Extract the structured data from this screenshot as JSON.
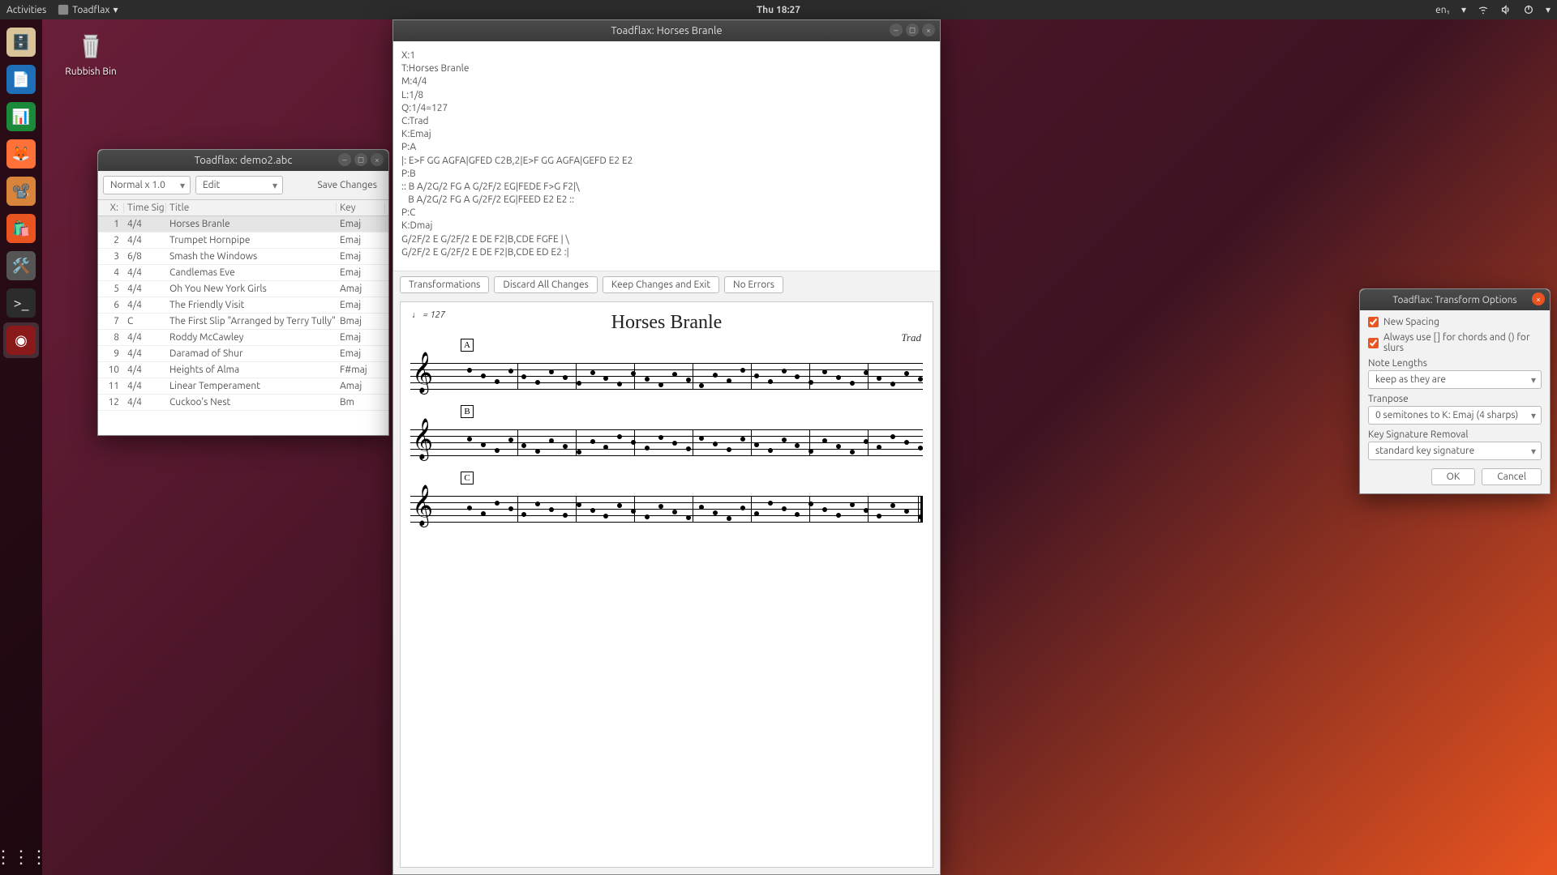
{
  "topbar": {
    "activities": "Activities",
    "app_name": "Toadflax",
    "clock": "Thu 18:27",
    "lang": "en₁"
  },
  "desktop": {
    "trash_label": "Rubbish Bin"
  },
  "tune_window": {
    "title": "Toadflax: demo2.abc",
    "speed_combo": "Normal x 1.0",
    "mode_combo": "Edit",
    "save_btn": "Save Changes",
    "columns": {
      "x": "X:",
      "ts": "Time Sig",
      "title": "Title",
      "key": "Key"
    },
    "rows": [
      {
        "x": "1",
        "ts": "4/4",
        "title": "Horses Branle",
        "key": "Emaj",
        "selected": true
      },
      {
        "x": "2",
        "ts": "4/4",
        "title": "Trumpet Hornpipe",
        "key": "Emaj"
      },
      {
        "x": "3",
        "ts": "6/8",
        "title": "Smash the Windows",
        "key": "Emaj"
      },
      {
        "x": "4",
        "ts": "4/4",
        "title": "Candlemas Eve",
        "key": "Emaj"
      },
      {
        "x": "5",
        "ts": "4/4",
        "title": "Oh You New York Girls",
        "key": "Amaj"
      },
      {
        "x": "6",
        "ts": "4/4",
        "title": "The Friendly Visit",
        "key": "Emaj"
      },
      {
        "x": "7",
        "ts": "C",
        "title": "The First Slip  \"Arranged by Terry Tully\"",
        "key": "Bmaj"
      },
      {
        "x": "8",
        "ts": "4/4",
        "title": "Roddy McCawley",
        "key": "Emaj"
      },
      {
        "x": "9",
        "ts": "4/4",
        "title": "Daramad of Shur",
        "key": "Emaj"
      },
      {
        "x": "10",
        "ts": "4/4",
        "title": "Heights of Alma",
        "key": "F#maj"
      },
      {
        "x": "11",
        "ts": "4/4",
        "title": "Linear Temperament",
        "key": "Amaj"
      },
      {
        "x": "12",
        "ts": "4/4",
        "title": "Cuckoo's Nest",
        "key": "Bm"
      }
    ]
  },
  "editor": {
    "title": "Toadflax: Horses Branle",
    "abc": "X:1\nT:Horses Branle\nM:4/4\nL:1/8\nQ:1/4=127\nC:Trad\nK:Emaj\nP:A\n|: E>F GG AGFA|GFED C2B,2|E>F GG AGFA|GEFD E2 E2\nP:B\n:: B A/2G/2 FG A G/2F/2 EG|FEDE F>G F2|\\\n   B A/2G/2 FG A G/2F/2 EG|FEED E2 E2 ::\nP:C\nK:Dmaj\nG/2F/2 E G/2F/2 E DE F2|B,CDE FGFE | \\\nG/2F/2 E G/2F/2 E DE F2|B,CDE ED E2 :|",
    "buttons": {
      "transform": "Transformations",
      "discard": "Discard All Changes",
      "keep": "Keep Changes and Exit",
      "errors": "No Errors"
    },
    "score": {
      "tempo": "♩ = 127",
      "title": "Horses Branle",
      "composer": "Trad",
      "parts": [
        "A",
        "B",
        "C"
      ]
    }
  },
  "dialog": {
    "title": "Toadflax: Transform Options",
    "new_spacing": "New Spacing",
    "use_brackets": "Always use [] for chords and () for slurs",
    "note_lengths_label": "Note Lengths",
    "note_lengths_value": "keep as they are",
    "transpose_label": "Tranpose",
    "transpose_value": "0 semitones to K: Emaj (4 sharps)",
    "keysig_label": "Key Signature Removal",
    "keysig_value": "standard key signature",
    "ok": "OK",
    "cancel": "Cancel"
  }
}
